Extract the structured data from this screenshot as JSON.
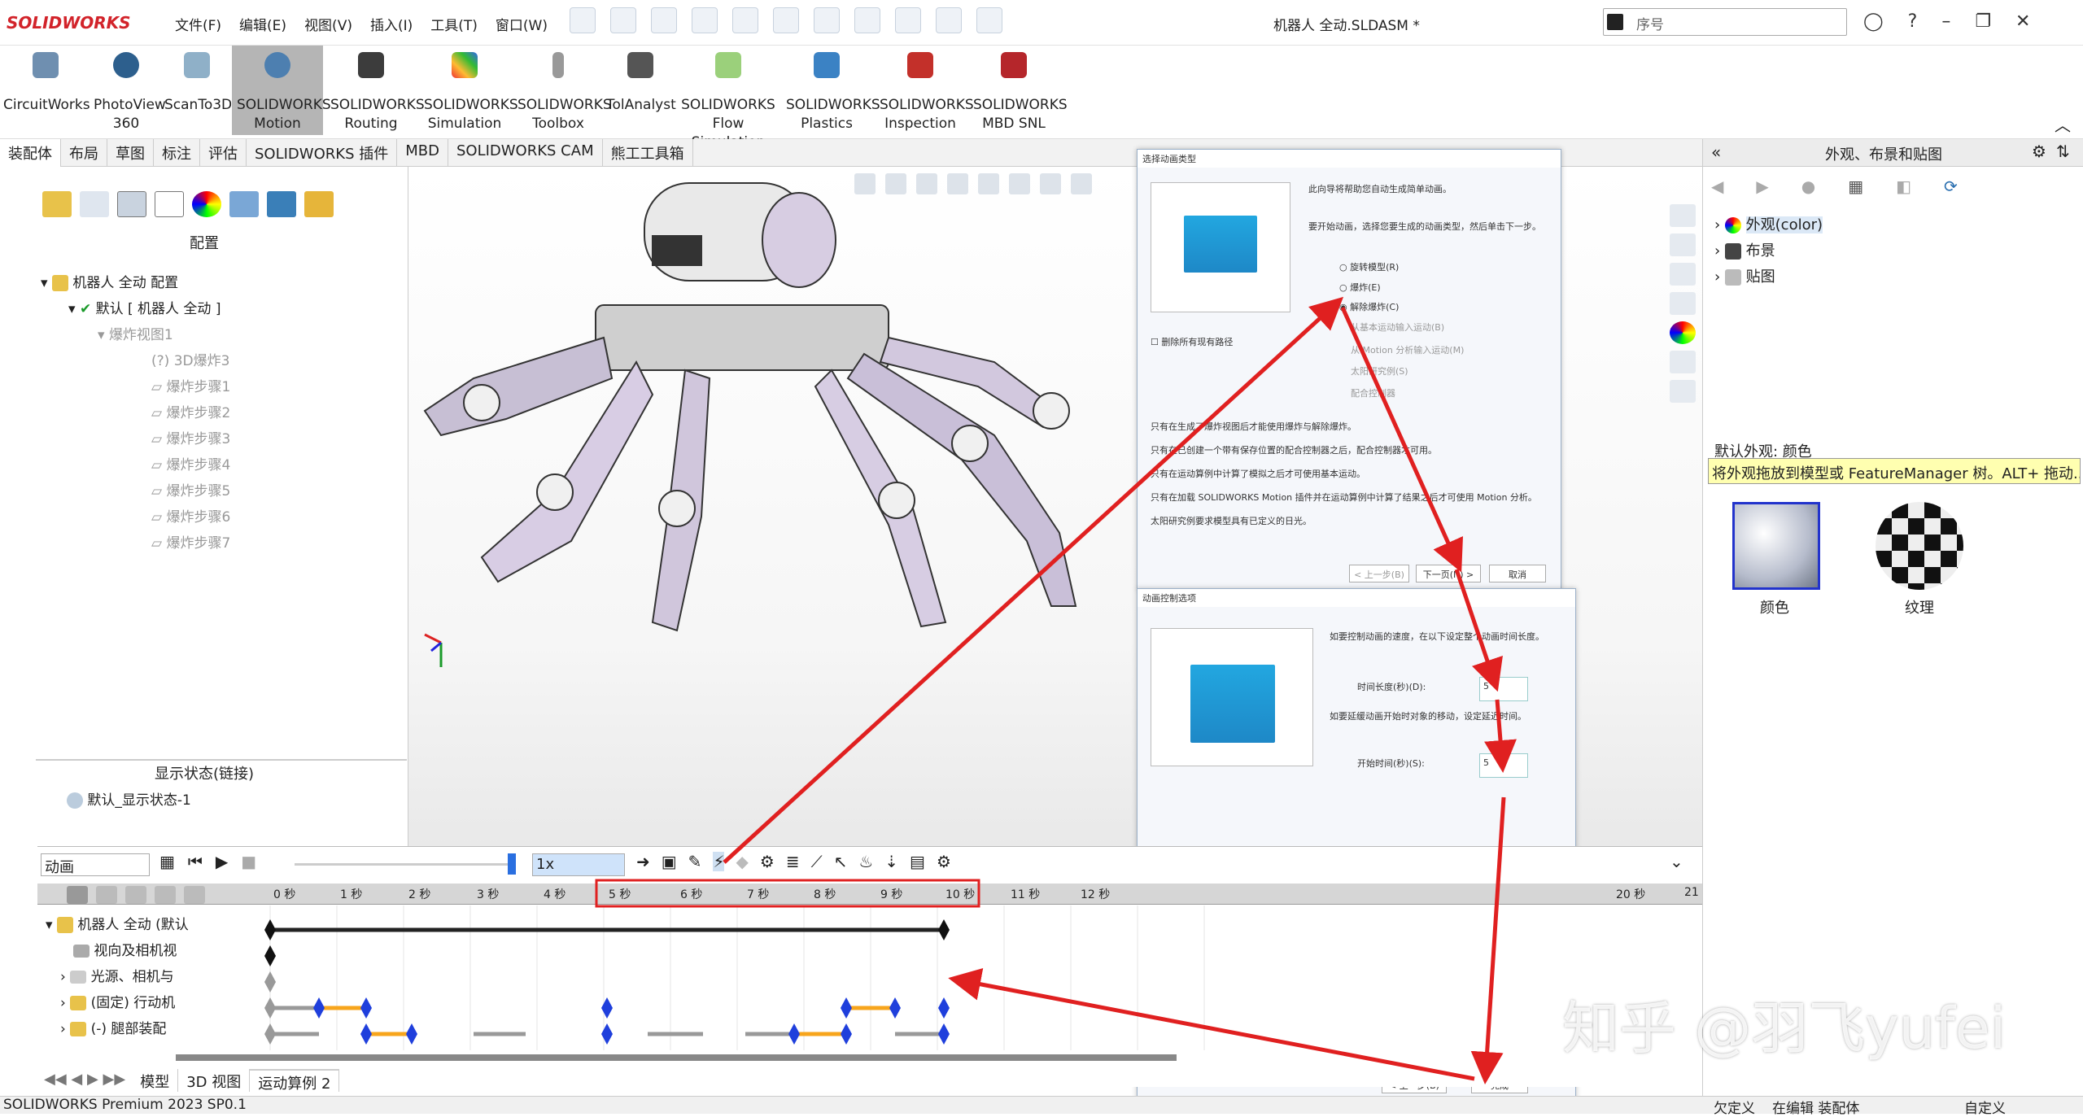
{
  "app": {
    "logo": "SOLIDWORKS",
    "title": "机器人 全动.SLDASM *",
    "search_placeholder": "序号",
    "status_left": "SOLIDWORKS Premium 2023 SP0.1",
    "status_r1": "欠定义",
    "status_r2": "在编辑 装配体",
    "status_r3": "自定义"
  },
  "menu": [
    "文件(F)",
    "编辑(E)",
    "视图(V)",
    "插入(I)",
    "工具(T)",
    "窗口(W)"
  ],
  "ribbon": [
    {
      "label": "CircuitWorks"
    },
    {
      "label": "PhotoView 360"
    },
    {
      "label": "ScanTo3D"
    },
    {
      "label": "SOLIDWORKS Motion"
    },
    {
      "label": "SOLIDWORKS Routing"
    },
    {
      "label": "SOLIDWORKS Simulation"
    },
    {
      "label": "SOLIDWORKS Toolbox"
    },
    {
      "label": "TolAnalyst"
    },
    {
      "label": "SOLIDWORKS Flow Simulation"
    },
    {
      "label": "SOLIDWORKS Plastics"
    },
    {
      "label": "SOLIDWORKS Inspection"
    },
    {
      "label": "SOLIDWORKS MBD SNL"
    }
  ],
  "tabs": [
    "装配体",
    "布局",
    "草图",
    "标注",
    "评估",
    "SOLIDWORKS 插件",
    "MBD",
    "SOLIDWORKS CAM",
    "熊工工具箱"
  ],
  "left": {
    "header": "配置",
    "root": "机器人 全动 配置",
    "default": "默认 [ 机器人 全动 ]",
    "explode": "爆炸视图1",
    "explode3d": "(?) 3D爆炸3",
    "steps": [
      "爆炸步骤1",
      "爆炸步骤2",
      "爆炸步骤3",
      "爆炸步骤4",
      "爆炸步骤5",
      "爆炸步骤6",
      "爆炸步骤7"
    ],
    "display_header": "显示状态(链接)",
    "display_item": "默认_显示状态-1"
  },
  "dialog1": {
    "title": "选择动画类型",
    "intro": "此向导将帮助您自动生成简单动画。",
    "prompt": "要开始动画，选择您要生成的动画类型，然后单击下一步。",
    "opts": [
      "旋转模型(R)",
      "爆炸(E)",
      "解除爆炸(C)",
      "从基本运动输入运动(B)",
      "从 Motion 分析输入运动(M)",
      "太阳研究例(S)",
      "配合控制器"
    ],
    "check": "删除所有现有路径",
    "notes": [
      "只有在生成了爆炸视图后才能使用爆炸与解除爆炸。",
      "只有在已创建一个带有保存位置的配合控制器之后，配合控制器才可用。",
      "只有在运动算例中计算了模拟之后才可使用基本运动。",
      "只有在加载 SOLIDWORKS Motion 插件并在运动算例中计算了结果之后才可使用 Motion 分析。",
      "太阳研究例要求模型具有已定义的日光。"
    ],
    "back": "< 上一步(B)",
    "next": "下一页(N) >",
    "cancel": "取消"
  },
  "dialog2": {
    "title": "动画控制选项",
    "p1": "如要控制动画的速度，在以下设定整个动画时间长度。",
    "l1": "时间长度(秒)(D):",
    "v1": "5",
    "p2": "如要延缓动画开始时对象的移动，设定延迟时间。",
    "l2": "开始时间(秒)(S):",
    "v2": "5",
    "back": "< 上一步(B)",
    "finish": "完成"
  },
  "right": {
    "title": "外观、布景和贴图",
    "items": [
      "外观(color)",
      "布景",
      "贴图"
    ],
    "info1": "默认外观: 颜色",
    "info2": "将外观拖放到模型或 FeatureManager 树。ALT+ 拖动...",
    "thumb1": "颜色",
    "thumb2": "纹理"
  },
  "motion": {
    "type": "动画",
    "speed": "1x",
    "ticks": [
      "0 秒",
      "1 秒",
      "2 秒",
      "3 秒",
      "4 秒",
      "5 秒",
      "6 秒",
      "7 秒",
      "8 秒",
      "9 秒",
      "10 秒",
      "11 秒",
      "12 秒",
      "20 秒",
      "21"
    ],
    "rows": [
      "机器人 全动 (默认",
      "视向及相机视",
      "光源、相机与",
      "(固定) 行动机",
      "(-) 腿部装配"
    ],
    "bottom_tabs": [
      "模型",
      "3D 视图",
      "运动算例 2"
    ]
  },
  "watermark": "知乎 @羽飞yufei",
  "colors": {
    "accent": "#d2232a",
    "keyframe": "#1f3fdc",
    "orange": "#f7a51c",
    "arrow": "#e02020"
  }
}
